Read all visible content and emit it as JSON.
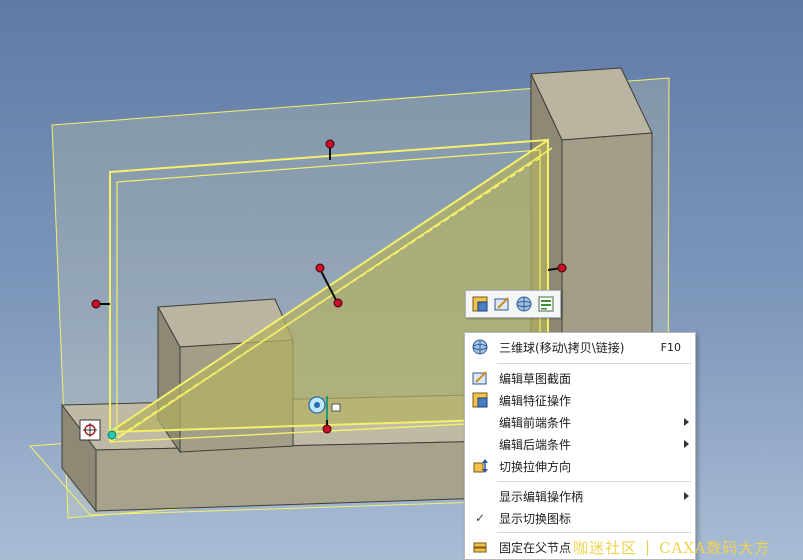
{
  "context_menu": {
    "items": [
      {
        "label": "三维球(移动\\拷贝\\链接)",
        "shortcut": "F10",
        "icon": "3d-sphere-icon"
      },
      {
        "label": "编辑草图截面",
        "icon": "edit-sketch-icon"
      },
      {
        "label": "编辑特征操作",
        "icon": "edit-feature-icon"
      },
      {
        "label": "编辑前端条件",
        "submenu": true
      },
      {
        "label": "编辑后端条件",
        "submenu": true
      },
      {
        "label": "切换拉伸方向",
        "icon": "switch-direction-icon"
      },
      {
        "label": "显示编辑操作柄",
        "submenu": true
      },
      {
        "label": "显示切换图标",
        "checked": true,
        "check_mark": "✓"
      },
      {
        "label": "固定在父节点",
        "icon": "pin-node-icon"
      }
    ]
  },
  "watermark": {
    "left": "咖迷社区",
    "divider": "|",
    "right": "CAXA数码大方"
  },
  "colors": {
    "background_top": "#5f7aa6",
    "background_bottom": "#a9bcd4",
    "selection_yellow": "#f4f06a",
    "handle_red": "#c8102e",
    "solid_face": "#a9a48c"
  }
}
